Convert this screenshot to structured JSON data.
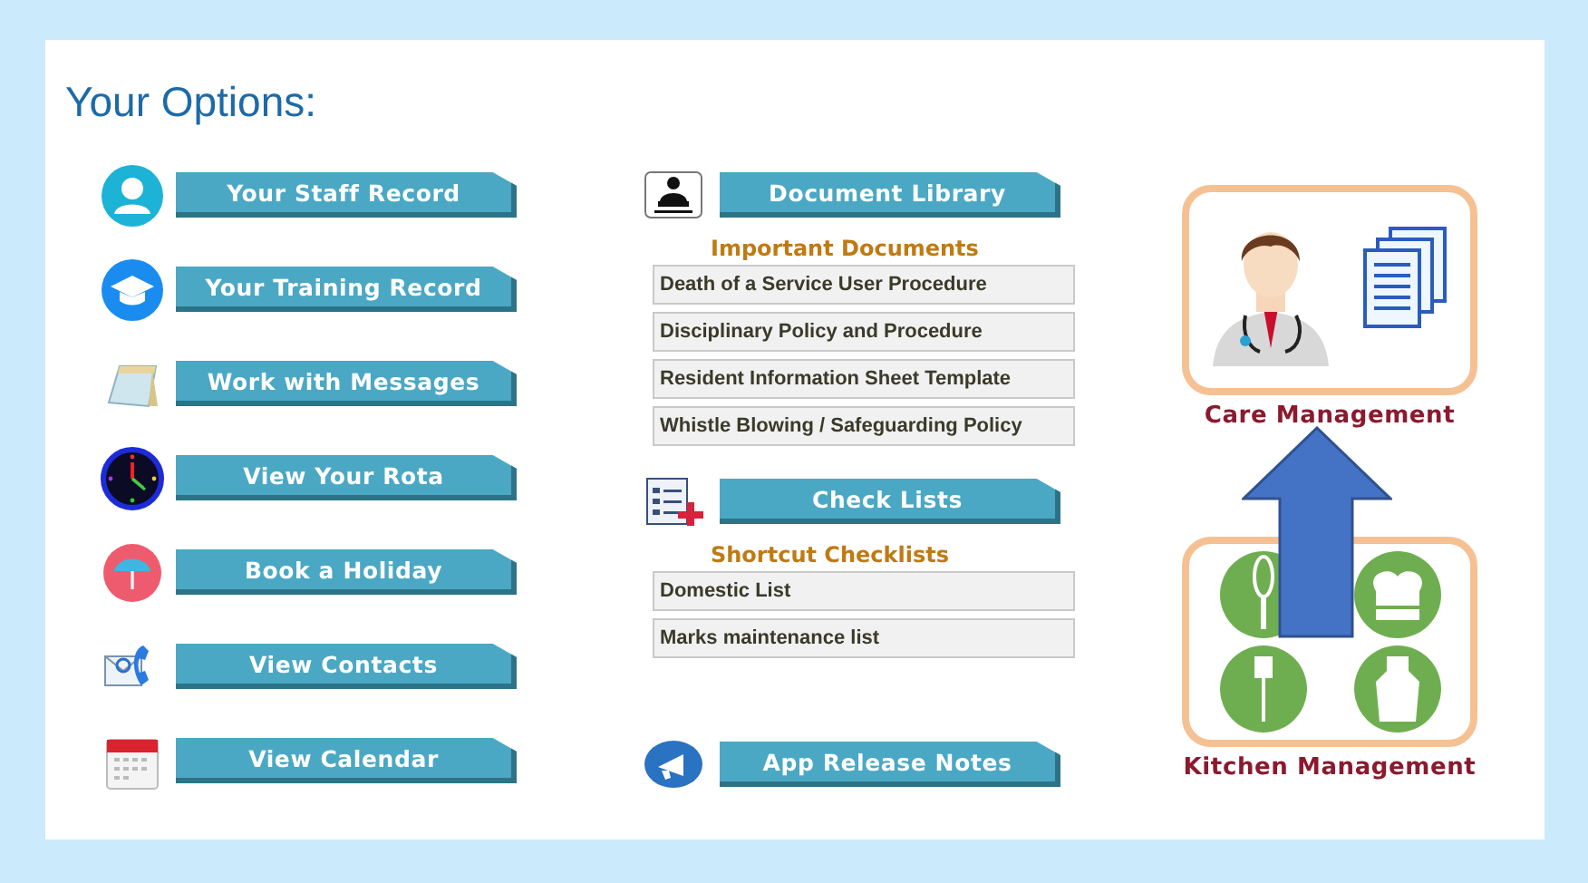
{
  "title": "Your Options:",
  "options": [
    {
      "label": "Your Staff Record",
      "kind": "person"
    },
    {
      "label": "Your Training Record",
      "kind": "cap"
    },
    {
      "label": "Work with Messages",
      "kind": "notepad"
    },
    {
      "label": "View Your Rota",
      "kind": "clock"
    },
    {
      "label": "Book a Holiday",
      "kind": "umbrella"
    },
    {
      "label": "View Contacts",
      "kind": "contacts"
    },
    {
      "label": "View Calendar",
      "kind": "calendar"
    }
  ],
  "document_library": {
    "label": "Document Library"
  },
  "important_documents": {
    "heading": "Important Documents",
    "items": [
      "Death of a Service User Procedure",
      "Disciplinary Policy and Procedure",
      "Resident Information Sheet Template",
      "Whistle Blowing / Safeguarding Policy"
    ]
  },
  "check_lists": {
    "label": "Check Lists"
  },
  "shortcut_checklists": {
    "heading": "Shortcut Checklists",
    "items": [
      "Domestic List",
      "Marks maintenance list"
    ]
  },
  "release_notes": {
    "label": "App Release Notes"
  },
  "tiles": [
    {
      "label": "Care Management",
      "kind": "care"
    },
    {
      "label": "Kitchen Management",
      "kind": "kitchen"
    }
  ]
}
